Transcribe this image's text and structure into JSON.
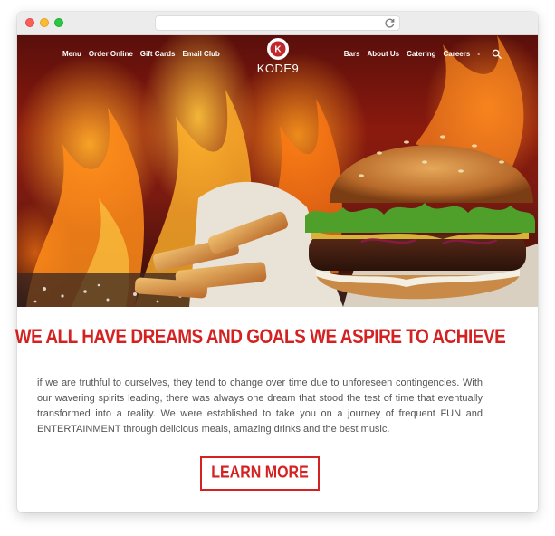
{
  "browser": {
    "url_text": ""
  },
  "nav": {
    "left_items": [
      "Menu",
      "Order Online",
      "Gift Cards",
      "Email Club"
    ],
    "right_items": [
      "Bars",
      "About Us",
      "Catering",
      "Careers",
      "-"
    ],
    "logo_text": "KODE9",
    "logo_glyph": "K"
  },
  "content": {
    "headline": "WE ALL HAVE DREAMS AND GOALS WE ASPIRE TO ACHIEVE",
    "paragraph": "if we are truthful to ourselves, they tend to change over time due to unforeseen contingencies. With our wavering spirits leading, there was always one dream that stood the test of time that eventually transformed into a reality. We were established to take you on a journey of frequent FUN and ENTERTAINMENT through delicious meals, amazing drinks and the best music.",
    "cta_label": "LEARN MORE"
  },
  "colors": {
    "accent": "#d42121",
    "text": "#555555"
  },
  "icons": {
    "search": "search-icon",
    "reload": "reload-icon"
  }
}
